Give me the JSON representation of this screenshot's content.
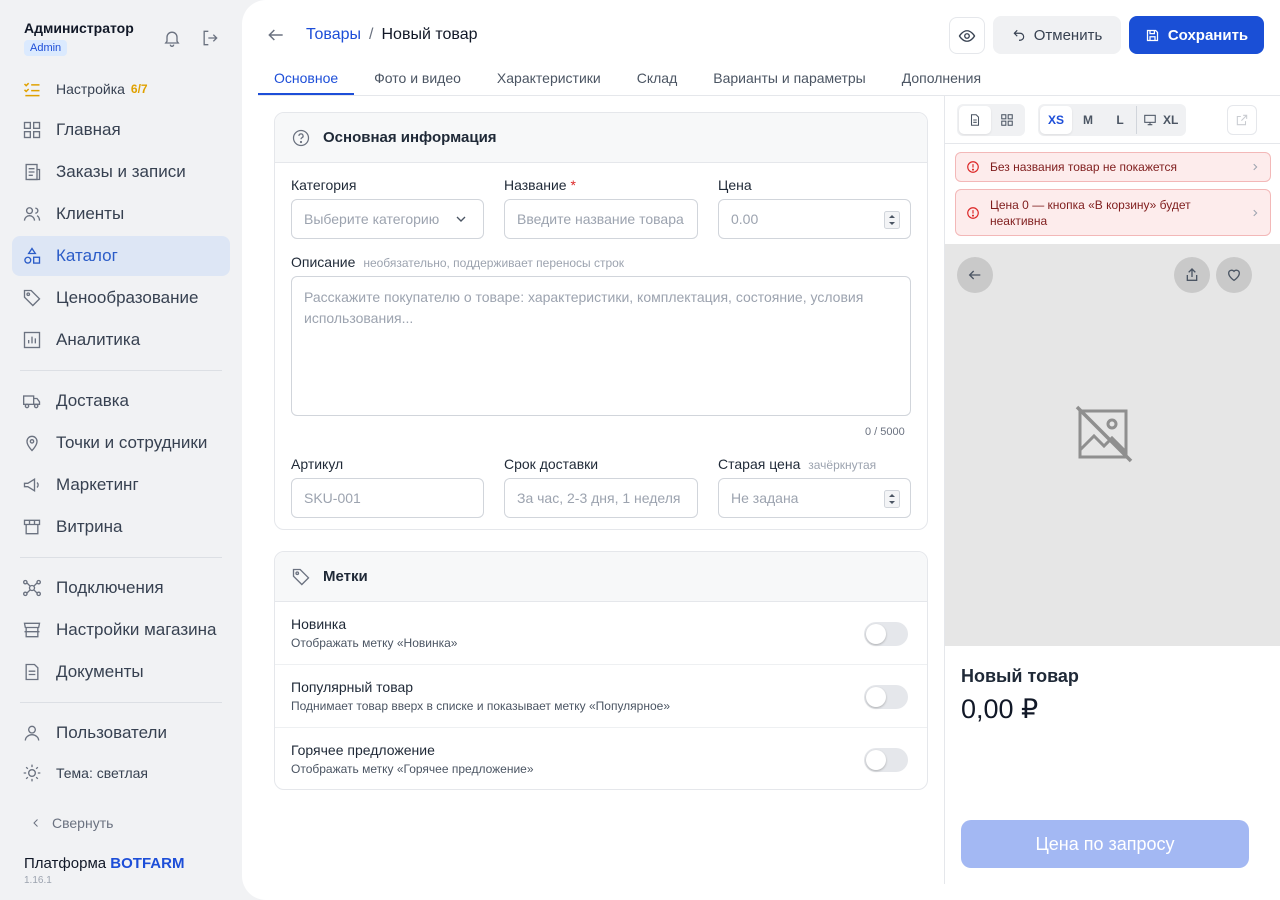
{
  "user": {
    "name": "Администратор",
    "role": "Admin"
  },
  "sidebar": {
    "setup": {
      "label": "Настройка",
      "count": "6/7"
    },
    "items": [
      {
        "label": "Главная",
        "icon": "grid-icon"
      },
      {
        "label": "Заказы и записи",
        "icon": "receipt-icon"
      },
      {
        "label": "Клиенты",
        "icon": "users-icon"
      },
      {
        "label": "Каталог",
        "icon": "shapes-icon",
        "active": true
      },
      {
        "label": "Ценообразование",
        "icon": "tag-icon"
      },
      {
        "label": "Аналитика",
        "icon": "chart-icon"
      },
      {
        "label": "Доставка",
        "icon": "truck-icon"
      },
      {
        "label": "Точки и сотрудники",
        "icon": "map-pin-icon"
      },
      {
        "label": "Маркетинг",
        "icon": "megaphone-icon"
      },
      {
        "label": "Витрина",
        "icon": "store-icon"
      },
      {
        "label": "Подключения",
        "icon": "network-icon"
      },
      {
        "label": "Настройки магазина",
        "icon": "shop-settings-icon"
      },
      {
        "label": "Документы",
        "icon": "document-icon"
      },
      {
        "label": "Пользователи",
        "icon": "user-icon"
      }
    ],
    "theme": "Тема: светлая",
    "collapse": "Свернуть",
    "platform_prefix": "Платформа",
    "platform_brand": "BOTFARM",
    "version": "1.16.1"
  },
  "header": {
    "breadcrumb_parent": "Товары",
    "breadcrumb_sep": "/",
    "breadcrumb_current": "Новый товар",
    "cancel_label": "Отменить",
    "save_label": "Сохранить"
  },
  "tabs": [
    "Основное",
    "Фото и видео",
    "Характеристики",
    "Склад",
    "Варианты и параметры",
    "Дополнения"
  ],
  "basic": {
    "title": "Основная информация",
    "category_label": "Категория",
    "category_placeholder": "Выберите категорию",
    "name_label": "Название",
    "name_required": "*",
    "name_placeholder": "Введите название товара",
    "price_label": "Цена",
    "price_placeholder": "0.00",
    "description_label": "Описание",
    "description_hint": "необязательно, поддерживает переносы строк",
    "description_placeholder": "Расскажите покупателю о товаре: характеристики, комплектация, состояние, условия использования...",
    "description_counter": "0 / 5000",
    "sku_label": "Артикул",
    "sku_placeholder": "SKU-001",
    "delivery_label": "Срок доставки",
    "delivery_placeholder": "За час, 2-3 дня, 1 неделя",
    "old_price_label": "Старая цена",
    "old_price_hint": "зачёркнутая",
    "old_price_placeholder": "Не задана"
  },
  "tags": {
    "title": "Метки",
    "items": [
      {
        "title": "Новинка",
        "desc": "Отображать метку «Новинка»",
        "on": false
      },
      {
        "title": "Популярный товар",
        "desc": "Поднимает товар вверх в списке и показывает метку «Популярное»",
        "on": false
      },
      {
        "title": "Горячее предложение",
        "desc": "Отображать метку «Горячее предложение»",
        "on": false
      }
    ]
  },
  "preview": {
    "sizes": [
      "XS",
      "M",
      "L",
      "XL"
    ],
    "selected_size": "XS",
    "warnings": [
      "Без названия товар не покажется",
      "Цена 0 — кнопка «В корзину» будет неактивна"
    ],
    "product_title": "Новый товар",
    "product_price": "0,00 ₽",
    "cta": "Цена по запросу"
  },
  "colors": {
    "primary": "#1a4fd6",
    "active_nav_bg": "#dde6f5",
    "warning_bg": "#fdecec",
    "setup_accent": "#e0a100"
  }
}
